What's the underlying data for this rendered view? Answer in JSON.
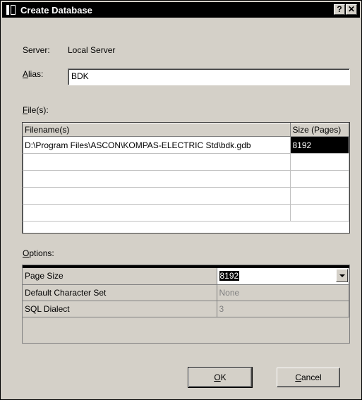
{
  "window": {
    "title": "Create Database",
    "help_label": "?",
    "close_label": "✕"
  },
  "server": {
    "label": "Server:",
    "value": "Local Server"
  },
  "alias": {
    "label_key": "A",
    "label_rest": "lias:",
    "value": "BDK"
  },
  "files": {
    "label_key": "F",
    "label_rest": "ile(s):",
    "columns": [
      "Filename(s)",
      "Size (Pages)"
    ],
    "rows": [
      {
        "filename": "D:\\Program Files\\ASCON\\KOMPAS-ELECTRIC Std\\bdk.gdb",
        "size": "8192"
      }
    ]
  },
  "options": {
    "label_key": "O",
    "label_rest": "ptions:",
    "rows": [
      {
        "name": "Page Size",
        "value": "8192"
      },
      {
        "name": "Default Character Set",
        "value": "None"
      },
      {
        "name": "SQL Dialect",
        "value": "3"
      }
    ]
  },
  "buttons": {
    "ok_key": "O",
    "ok_rest": "K",
    "cancel_key": "C",
    "cancel_rest": "ancel"
  },
  "colors": {
    "selection": "#000000",
    "face": "#d4d0c8",
    "disabled_text": "#808080"
  }
}
